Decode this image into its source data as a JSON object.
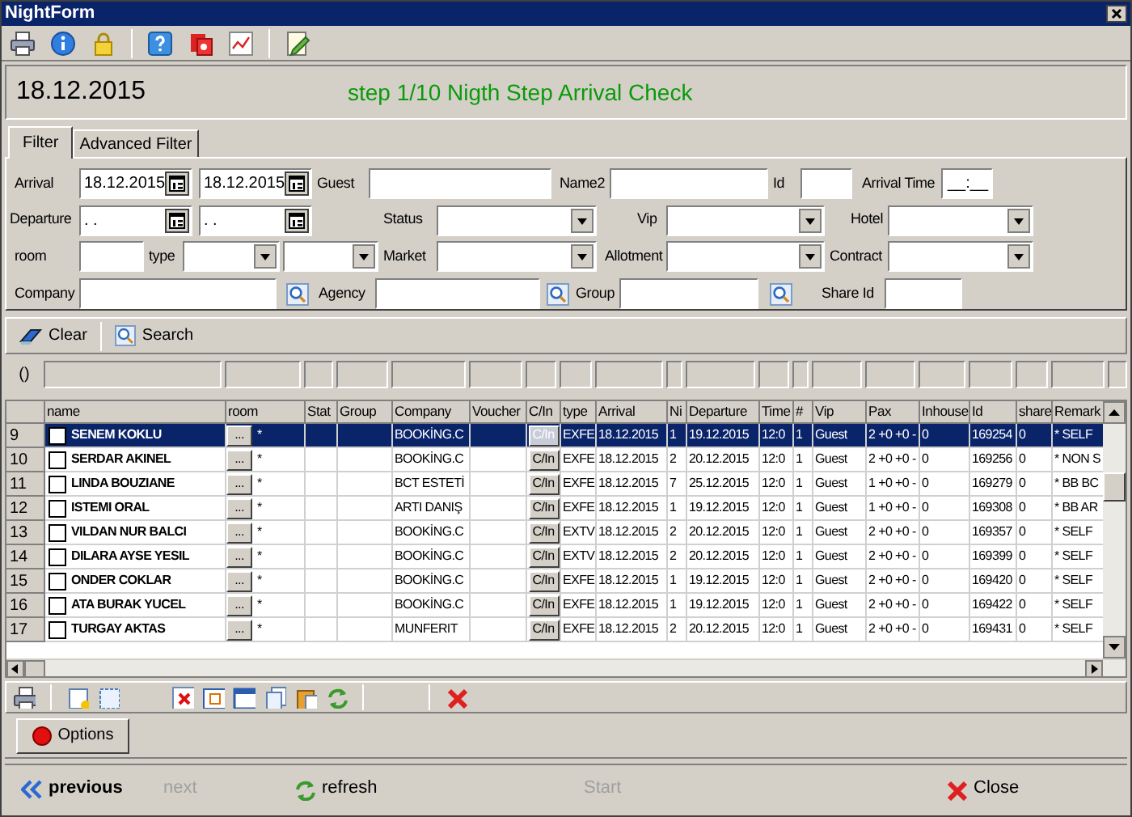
{
  "window": {
    "title": "NightForm"
  },
  "header": {
    "date": "18.12.2015",
    "step": "step 1/10 Nigth Step Arrival Check"
  },
  "filter_tabs": [
    {
      "label": "Filter",
      "selected": true
    },
    {
      "label": "Advanced Filter",
      "selected": false
    }
  ],
  "filter_rows": [
    [
      {
        "kind": "label",
        "text": "Arrival"
      },
      {
        "kind": "date",
        "value": "18.12.2015"
      },
      {
        "kind": "date",
        "value": "18.12.2015"
      },
      {
        "kind": "label",
        "text": "Guest"
      },
      {
        "kind": "text"
      },
      {
        "kind": "label",
        "text": "Name2"
      },
      {
        "kind": "text"
      },
      {
        "kind": "label",
        "text": "Id"
      },
      {
        "kind": "text"
      },
      {
        "kind": "label",
        "text": "Arrival Time"
      },
      {
        "kind": "text",
        "value": "__:__"
      }
    ],
    [
      {
        "kind": "label",
        "text": "Departure"
      },
      {
        "kind": "date",
        "value": ". ."
      },
      {
        "kind": "date",
        "value": ". ."
      },
      {
        "kind": "label",
        "text": "Status"
      },
      {
        "kind": "select"
      },
      {
        "kind": "label",
        "text": "Vip"
      },
      {
        "kind": "select"
      },
      {
        "kind": "label",
        "text": "Hotel"
      },
      {
        "kind": "select"
      }
    ],
    [
      {
        "kind": "label",
        "text": "room"
      },
      {
        "kind": "text"
      },
      {
        "kind": "label",
        "text": "type"
      },
      {
        "kind": "select"
      },
      {
        "kind": "select"
      },
      {
        "kind": "label",
        "text": "Market"
      },
      {
        "kind": "select"
      },
      {
        "kind": "label",
        "text": "Allotment"
      },
      {
        "kind": "select"
      },
      {
        "kind": "label",
        "text": "Contract"
      },
      {
        "kind": "select"
      }
    ],
    [
      {
        "kind": "label",
        "text": "Company"
      },
      {
        "kind": "text"
      },
      {
        "kind": "lookup"
      },
      {
        "kind": "label",
        "text": "Agency"
      },
      {
        "kind": "text"
      },
      {
        "kind": "lookup"
      },
      {
        "kind": "label",
        "text": "Group"
      },
      {
        "kind": "text"
      },
      {
        "kind": "lookup"
      },
      {
        "kind": "label",
        "text": "Share Id"
      },
      {
        "kind": "text"
      }
    ]
  ],
  "filter_actions": [
    {
      "kind": "clear",
      "label": "Clear"
    },
    {
      "kind": "search",
      "label": "Search"
    }
  ],
  "column_filter": {
    "label": "()"
  },
  "table": {
    "columns": [
      "name",
      "room",
      "Stat",
      "Group",
      "Company",
      "Voucher",
      "C/In",
      "type",
      "Arrival",
      "Ni",
      "Departure",
      "Time",
      "#",
      "Vip",
      "Pax",
      "Inhouse",
      "Id",
      "share",
      "Remark"
    ],
    "rows": [
      {
        "number": "9",
        "selected": true,
        "checked": false,
        "name": "SENEM KOKLU",
        "room_button": "...",
        "room": "*",
        "company": "BOOKİNG.C",
        "cin": "C/In",
        "type": "EXFE",
        "arrival": "18.12.2015",
        "nights": "1",
        "departure": "19.12.2015",
        "time": "12:0",
        "count": "1",
        "vip": "Guest",
        "pax": "2 +0 +0 -",
        "inhouse": "0",
        "id": "169254",
        "share": "0",
        "remark": "* SELF"
      },
      {
        "number": "10",
        "selected": false,
        "checked": false,
        "name": "SERDAR AKINEL",
        "room_button": "...",
        "room": "*",
        "company": "BOOKİNG.C",
        "cin": "C/In",
        "type": "EXFE",
        "arrival": "18.12.2015",
        "nights": "2",
        "departure": "20.12.2015",
        "time": "12:0",
        "count": "1",
        "vip": "Guest",
        "pax": "2 +0 +0 -",
        "inhouse": "0",
        "id": "169256",
        "share": "0",
        "remark": "* NON S"
      },
      {
        "number": "11",
        "selected": false,
        "checked": false,
        "name": "LINDA BOUZIANE",
        "room_button": "...",
        "room": "*",
        "company": "BCT ESTETİ",
        "cin": "C/In",
        "type": "EXFE",
        "arrival": "18.12.2015",
        "nights": "7",
        "departure": "25.12.2015",
        "time": "12:0",
        "count": "1",
        "vip": "Guest",
        "pax": "1 +0 +0 -",
        "inhouse": "0",
        "id": "169279",
        "share": "0",
        "remark": "* BB BC"
      },
      {
        "number": "12",
        "selected": false,
        "checked": false,
        "name": "ISTEMI ORAL",
        "room_button": "...",
        "room": "*",
        "company": "ARTI DANIŞ",
        "cin": "C/In",
        "type": "EXFE",
        "arrival": "18.12.2015",
        "nights": "1",
        "departure": "19.12.2015",
        "time": "12:0",
        "count": "1",
        "vip": "Guest",
        "pax": "1 +0 +0 -",
        "inhouse": "0",
        "id": "169308",
        "share": "0",
        "remark": "* BB AR"
      },
      {
        "number": "13",
        "selected": false,
        "checked": false,
        "name": "VILDAN NUR BALCI",
        "room_button": "...",
        "room": "*",
        "company": "BOOKİNG.C",
        "cin": "C/In",
        "type": "EXTV",
        "arrival": "18.12.2015",
        "nights": "2",
        "departure": "20.12.2015",
        "time": "12:0",
        "count": "1",
        "vip": "Guest",
        "pax": "2 +0 +0 -",
        "inhouse": "0",
        "id": "169357",
        "share": "0",
        "remark": "* SELF"
      },
      {
        "number": "14",
        "selected": false,
        "checked": false,
        "name": "DILARA AYSE YESIL",
        "room_button": "...",
        "room": "*",
        "company": "BOOKİNG.C",
        "cin": "C/In",
        "type": "EXTV",
        "arrival": "18.12.2015",
        "nights": "2",
        "departure": "20.12.2015",
        "time": "12:0",
        "count": "1",
        "vip": "Guest",
        "pax": "2 +0 +0 -",
        "inhouse": "0",
        "id": "169399",
        "share": "0",
        "remark": "* SELF"
      },
      {
        "number": "15",
        "selected": false,
        "checked": false,
        "name": "ONDER COKLAR",
        "room_button": "...",
        "room": "*",
        "company": "BOOKİNG.C",
        "cin": "C/In",
        "type": "EXFE",
        "arrival": "18.12.2015",
        "nights": "1",
        "departure": "19.12.2015",
        "time": "12:0",
        "count": "1",
        "vip": "Guest",
        "pax": "2 +0 +0 -",
        "inhouse": "0",
        "id": "169420",
        "share": "0",
        "remark": "* SELF"
      },
      {
        "number": "16",
        "selected": false,
        "checked": false,
        "name": "ATA BURAK YUCEL",
        "room_button": "...",
        "room": "*",
        "company": "BOOKİNG.C",
        "cin": "C/In",
        "type": "EXFE",
        "arrival": "18.12.2015",
        "nights": "1",
        "departure": "19.12.2015",
        "time": "12:0",
        "count": "1",
        "vip": "Guest",
        "pax": "2 +0 +0 -",
        "inhouse": "0",
        "id": "169422",
        "share": "0",
        "remark": "* SELF"
      },
      {
        "number": "17",
        "selected": false,
        "checked": false,
        "name": "TURGAY AKTAS",
        "room_button": "...",
        "room": "*",
        "company": "MUNFERIT",
        "cin": "C/In",
        "type": "EXFE",
        "arrival": "18.12.2015",
        "nights": "2",
        "departure": "20.12.2015",
        "time": "12:0",
        "count": "1",
        "vip": "Guest",
        "pax": "2 +0 +0 -",
        "inhouse": "0",
        "id": "169431",
        "share": "0",
        "remark": "* SELF"
      }
    ]
  },
  "options_button": {
    "label": "Options"
  },
  "nav": [
    {
      "kind": "previous",
      "label": "previous",
      "disabled": false
    },
    {
      "kind": "plain",
      "label": "next",
      "disabled": true
    },
    {
      "kind": "refresh",
      "label": "refresh",
      "disabled": false
    },
    {
      "kind": "plain",
      "label": "Start",
      "disabled": true
    },
    {
      "kind": "close",
      "label": "Close",
      "disabled": false
    }
  ]
}
